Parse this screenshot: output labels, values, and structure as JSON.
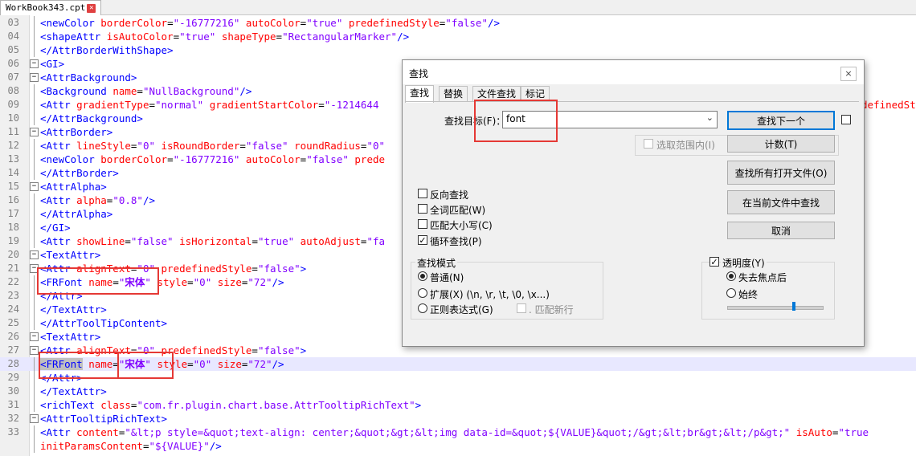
{
  "tab": {
    "filename": "WorkBook343.cpt"
  },
  "editor": {
    "lines": [
      {
        "n": "03",
        "segs": [
          [
            "tg",
            "<newColor "
          ],
          [
            "at",
            "borderColor"
          ],
          [
            "tx",
            "="
          ],
          [
            "vl",
            "\"-16777216\""
          ],
          [
            "tx",
            " "
          ],
          [
            "at",
            "autoColor"
          ],
          [
            "tx",
            "="
          ],
          [
            "vl",
            "\"true\""
          ],
          [
            "tx",
            " "
          ],
          [
            "at",
            "predefinedStyle"
          ],
          [
            "tx",
            "="
          ],
          [
            "vl",
            "\"false\""
          ],
          [
            "tg",
            "/>"
          ]
        ]
      },
      {
        "n": "04",
        "segs": [
          [
            "tg",
            "<shapeAttr "
          ],
          [
            "at",
            "isAutoColor"
          ],
          [
            "tx",
            "="
          ],
          [
            "vl",
            "\"true\""
          ],
          [
            "tx",
            " "
          ],
          [
            "at",
            "shapeType"
          ],
          [
            "tx",
            "="
          ],
          [
            "vl",
            "\"RectangularMarker\""
          ],
          [
            "tg",
            "/>"
          ]
        ]
      },
      {
        "n": "05",
        "segs": [
          [
            "tg",
            "</AttrBorderWithShape>"
          ]
        ]
      },
      {
        "n": "06",
        "fold": "-",
        "segs": [
          [
            "tg",
            "<GI>"
          ]
        ]
      },
      {
        "n": "07",
        "fold": "-",
        "segs": [
          [
            "tg",
            "<AttrBackground>"
          ]
        ]
      },
      {
        "n": "08",
        "segs": [
          [
            "tg",
            "<Background "
          ],
          [
            "at",
            "name"
          ],
          [
            "tx",
            "="
          ],
          [
            "vl",
            "\"NullBackground\""
          ],
          [
            "tg",
            "/>"
          ]
        ]
      },
      {
        "n": "09",
        "segs": [
          [
            "tg",
            "<Attr "
          ],
          [
            "at",
            "gradientType"
          ],
          [
            "tx",
            "="
          ],
          [
            "vl",
            "\"normal\""
          ],
          [
            "tx",
            " "
          ],
          [
            "at",
            "gradientStartColor"
          ],
          [
            "tx",
            "="
          ],
          [
            "vl",
            "\"-1214644"
          ]
        ]
      },
      {
        "n": "10",
        "segs": [
          [
            "tg",
            "</AttrBackground>"
          ]
        ]
      },
      {
        "n": "11",
        "fold": "-",
        "segs": [
          [
            "tg",
            "<AttrBorder>"
          ]
        ]
      },
      {
        "n": "12",
        "segs": [
          [
            "tg",
            "<Attr "
          ],
          [
            "at",
            "lineStyle"
          ],
          [
            "tx",
            "="
          ],
          [
            "vl",
            "\"0\""
          ],
          [
            "tx",
            " "
          ],
          [
            "at",
            "isRoundBorder"
          ],
          [
            "tx",
            "="
          ],
          [
            "vl",
            "\"false\""
          ],
          [
            "tx",
            " "
          ],
          [
            "at",
            "roundRadius"
          ],
          [
            "tx",
            "="
          ],
          [
            "vl",
            "\"0\""
          ]
        ]
      },
      {
        "n": "13",
        "segs": [
          [
            "tg",
            "<newColor "
          ],
          [
            "at",
            "borderColor"
          ],
          [
            "tx",
            "="
          ],
          [
            "vl",
            "\"-16777216\""
          ],
          [
            "tx",
            " "
          ],
          [
            "at",
            "autoColor"
          ],
          [
            "tx",
            "="
          ],
          [
            "vl",
            "\"false\""
          ],
          [
            "tx",
            " "
          ],
          [
            "at",
            "prede"
          ]
        ]
      },
      {
        "n": "14",
        "segs": [
          [
            "tg",
            "</AttrBorder>"
          ]
        ]
      },
      {
        "n": "15",
        "fold": "-",
        "segs": [
          [
            "tg",
            "<AttrAlpha>"
          ]
        ]
      },
      {
        "n": "16",
        "segs": [
          [
            "tg",
            "<Attr "
          ],
          [
            "at",
            "alpha"
          ],
          [
            "tx",
            "="
          ],
          [
            "vl",
            "\"0.8\""
          ],
          [
            "tg",
            "/>"
          ]
        ]
      },
      {
        "n": "17",
        "segs": [
          [
            "tg",
            "</AttrAlpha>"
          ]
        ]
      },
      {
        "n": "18",
        "segs": [
          [
            "tg",
            "</GI>"
          ]
        ]
      },
      {
        "n": "19",
        "segs": [
          [
            "tg",
            "<Attr "
          ],
          [
            "at",
            "showLine"
          ],
          [
            "tx",
            "="
          ],
          [
            "vl",
            "\"false\""
          ],
          [
            "tx",
            " "
          ],
          [
            "at",
            "isHorizontal"
          ],
          [
            "tx",
            "="
          ],
          [
            "vl",
            "\"true\""
          ],
          [
            "tx",
            " "
          ],
          [
            "at",
            "autoAdjust"
          ],
          [
            "tx",
            "="
          ],
          [
            "vl",
            "\"fa"
          ]
        ]
      },
      {
        "n": "20",
        "fold": "-",
        "segs": [
          [
            "tg",
            "<TextAttr>"
          ]
        ]
      },
      {
        "n": "21",
        "fold": "-",
        "segs": [
          [
            "tg",
            "<Attr "
          ],
          [
            "at",
            "alignText"
          ],
          [
            "tx",
            "="
          ],
          [
            "vl",
            "\"0\""
          ],
          [
            "tx",
            " "
          ],
          [
            "at",
            "predefinedStyle"
          ],
          [
            "tx",
            "="
          ],
          [
            "vl",
            "\"false\""
          ],
          [
            "tg",
            ">"
          ]
        ]
      },
      {
        "n": "22",
        "segs": [
          [
            "tg",
            "<FRFont "
          ],
          [
            "at",
            "name"
          ],
          [
            "tx",
            "="
          ],
          [
            "vl",
            "\""
          ],
          [
            "cjk",
            "宋体"
          ],
          [
            "vl",
            "\""
          ],
          [
            "tx",
            " "
          ],
          [
            "at",
            "style"
          ],
          [
            "tx",
            "="
          ],
          [
            "vl",
            "\"0\""
          ],
          [
            "tx",
            " "
          ],
          [
            "at",
            "size"
          ],
          [
            "tx",
            "="
          ],
          [
            "vl",
            "\"72\""
          ],
          [
            "tg",
            "/>"
          ]
        ]
      },
      {
        "n": "23",
        "segs": [
          [
            "tg",
            "</Attr>"
          ]
        ]
      },
      {
        "n": "24",
        "segs": [
          [
            "tg",
            "</TextAttr>"
          ]
        ]
      },
      {
        "n": "25",
        "segs": [
          [
            "tg",
            "</AttrToolTipContent>"
          ]
        ]
      },
      {
        "n": "26",
        "fold": "-",
        "segs": [
          [
            "tg",
            "<TextAttr>"
          ]
        ]
      },
      {
        "n": "27",
        "fold": "-",
        "segs": [
          [
            "tg",
            "<Attr "
          ],
          [
            "at",
            "alignText"
          ],
          [
            "tx",
            "="
          ],
          [
            "vl",
            "\"0\""
          ],
          [
            "tx",
            " "
          ],
          [
            "at",
            "predefinedStyle"
          ],
          [
            "tx",
            "="
          ],
          [
            "vl",
            "\"false\""
          ],
          [
            "tg",
            ">"
          ]
        ]
      },
      {
        "n": "28",
        "hl": true,
        "segs": [
          [
            "sel",
            "<FRFont"
          ],
          [
            "tx",
            " "
          ],
          [
            "at",
            "name"
          ],
          [
            "tx",
            "="
          ],
          [
            "vl",
            "\""
          ],
          [
            "cjk",
            "宋体"
          ],
          [
            "vl",
            "\""
          ],
          [
            "tx",
            " "
          ],
          [
            "at",
            "style"
          ],
          [
            "tx",
            "="
          ],
          [
            "vl",
            "\"0\""
          ],
          [
            "tx",
            " "
          ],
          [
            "at",
            "size"
          ],
          [
            "tx",
            "="
          ],
          [
            "vl",
            "\"72\""
          ],
          [
            "tg",
            "/>"
          ]
        ]
      },
      {
        "n": "29",
        "segs": [
          [
            "tg",
            "</Attr>"
          ]
        ]
      },
      {
        "n": "30",
        "segs": [
          [
            "tg",
            "</TextAttr>"
          ]
        ]
      },
      {
        "n": "31",
        "segs": [
          [
            "tg",
            "<richText "
          ],
          [
            "at",
            "class"
          ],
          [
            "tx",
            "="
          ],
          [
            "vl",
            "\"com.fr.plugin.chart.base.AttrTooltipRichText\""
          ],
          [
            "tg",
            ">"
          ]
        ]
      },
      {
        "n": "32",
        "fold": "-",
        "segs": [
          [
            "tg",
            "<AttrTooltipRichText>"
          ]
        ]
      },
      {
        "n": "33",
        "segs": [
          [
            "tg",
            "<Attr "
          ],
          [
            "at",
            "content"
          ],
          [
            "tx",
            "="
          ],
          [
            "vl",
            "\"&lt;p style=&quot;text-align: center;&quot;&gt;&lt;img data-id=&quot;${VALUE}&quot;/&gt;&lt;br&gt;&lt;/p&gt;\""
          ],
          [
            "tx",
            " "
          ],
          [
            "at",
            "isAuto"
          ],
          [
            "tx",
            "="
          ],
          [
            "vl",
            "\"true"
          ]
        ]
      },
      {
        "n": "",
        "segs": [
          [
            "at",
            "initParamsContent"
          ],
          [
            "tx",
            "="
          ],
          [
            "vl",
            "\"${VALUE}\""
          ],
          [
            "tg",
            "/>"
          ]
        ]
      }
    ],
    "overflow_right": "definedSt"
  },
  "dialog": {
    "title": "查找",
    "close": "×",
    "tabs": [
      "查找",
      "替换",
      "文件查找",
      "标记"
    ],
    "target_label": "查找目标(F)：",
    "target_value": "font",
    "in_selection": "选取范围内(I)",
    "buttons": {
      "find_next": "查找下一个",
      "count": "计数(T)",
      "find_all_open": "查找所有打开文件(O)",
      "find_current": "在当前文件中查找",
      "cancel": "取消"
    },
    "options": [
      {
        "label": "反向查找",
        "checked": false
      },
      {
        "label": "全词匹配(W)",
        "checked": false
      },
      {
        "label": "匹配大小写(C)",
        "checked": false
      },
      {
        "label": "循环查找(P)",
        "checked": true
      }
    ],
    "mode": {
      "title": "查找模式",
      "normal": "普通(N)",
      "extended": "扩展(X) (\\n, \\r, \\t, \\0, \\x...)",
      "regex": "正则表达式(G)",
      "dot_newline": ". 匹配新行"
    },
    "transparency": {
      "label": "透明度(Y)",
      "checked": true,
      "on_lose_focus": "失去焦点后",
      "always": "始终",
      "slider_value": 0.7
    }
  }
}
